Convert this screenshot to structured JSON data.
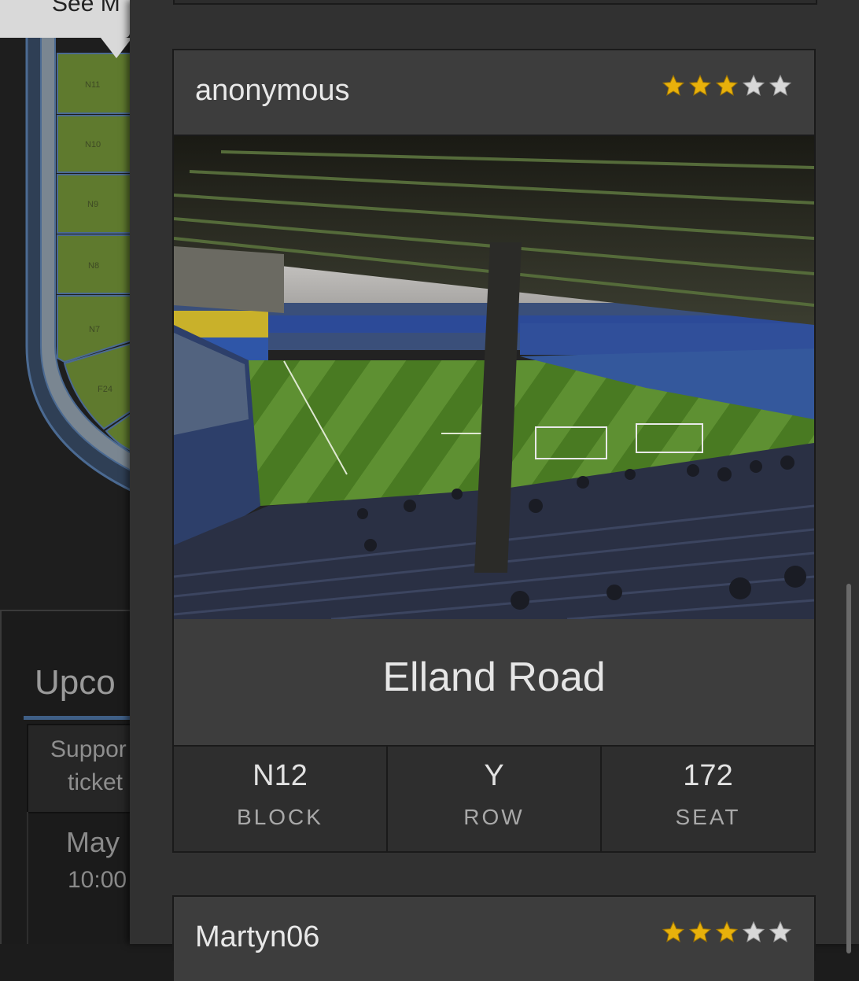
{
  "background_page": {
    "tooltip_text": "See M",
    "map_sections": [
      "N11",
      "N10",
      "N9",
      "N8",
      "N7",
      "F24"
    ],
    "heading": "Upco",
    "supporter_box": {
      "line1": "Suppor",
      "line2": "ticket"
    },
    "date": "May",
    "time": "10:00"
  },
  "reviews": [
    {
      "username": "anonymous",
      "rating": 3,
      "max_rating": 5,
      "venue": "Elland Road",
      "block_value": "N12",
      "block_label": "BLOCK",
      "row_value": "Y",
      "row_label": "ROW",
      "seat_value": "172",
      "seat_label": "SEAT"
    },
    {
      "username": "Martyn06",
      "rating": 3,
      "max_rating": 5
    }
  ],
  "colors": {
    "star_filled": "#e8b10b",
    "star_empty": "#d8d8d8",
    "map_section": "#5f7a2e",
    "map_border": "#3f5f86"
  },
  "icons": {
    "star_filled": "star-filled-icon",
    "star_empty": "star-empty-icon"
  }
}
